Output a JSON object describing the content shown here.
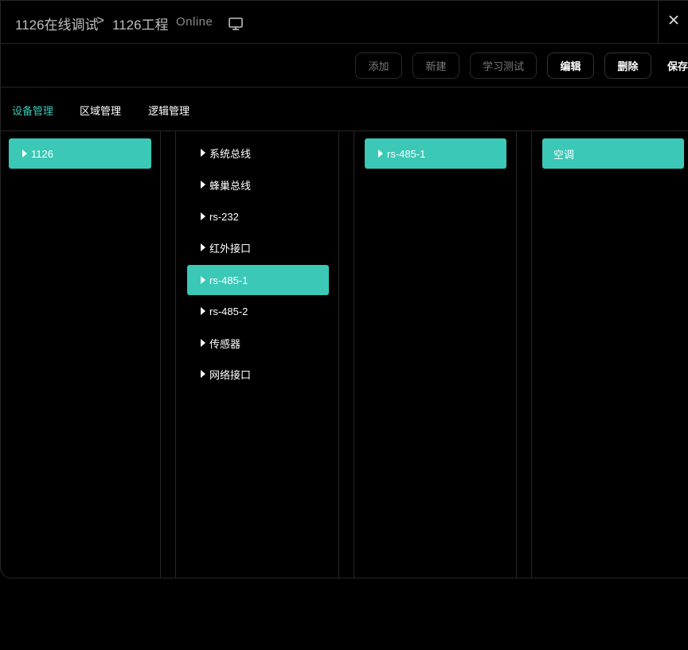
{
  "header": {
    "project": "1126在线调试",
    "separator": ">",
    "subproject": "1126工程",
    "status": "Online",
    "icons": {
      "device": "monitor-icon",
      "close": "close-icon"
    }
  },
  "toolbar": {
    "add_label": "添加",
    "new_label": "新建",
    "learn_test_label": "学习测试",
    "edit_label": "编辑",
    "delete_label": "删除",
    "save_label": "保存"
  },
  "tabs": [
    {
      "label": "设备管理",
      "active": true
    },
    {
      "label": "区域管理",
      "active": false
    },
    {
      "label": "逻辑管理",
      "active": false
    }
  ],
  "columns": {
    "col1": [
      {
        "label": "1126",
        "selected": true
      }
    ],
    "col2": [
      {
        "label": "系统总线",
        "selected": false
      },
      {
        "label": "蜂巢总线",
        "selected": false
      },
      {
        "label": "rs-232",
        "selected": false
      },
      {
        "label": "红外接口",
        "selected": false
      },
      {
        "label": "rs-485-1",
        "selected": true
      },
      {
        "label": "rs-485-2",
        "selected": false
      },
      {
        "label": "传感器",
        "selected": false
      },
      {
        "label": "网络接口",
        "selected": false
      }
    ],
    "col3": [
      {
        "label": "rs-485-1",
        "selected": true
      }
    ],
    "col4": [
      {
        "label": "空调",
        "selected": true
      }
    ]
  },
  "colors": {
    "accent": "#3bc8b7",
    "background": "#000000",
    "border": "#262626"
  }
}
